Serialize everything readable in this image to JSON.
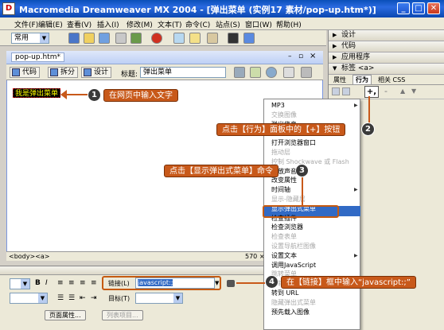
{
  "window": {
    "title": "Macromedia Dreamweaver MX 2004 - [弹出菜单 (实例17  素材/pop-up.htm*)]",
    "controls": [
      "_",
      "□",
      "✕"
    ]
  },
  "menubar": [
    "文件(F)",
    "编辑(E)",
    "查看(V)",
    "插入(I)",
    "修改(M)",
    "文本(T)",
    "命令(C)",
    "站点(S)",
    "窗口(W)",
    "帮助(H)"
  ],
  "insert_bar": {
    "category": "常用"
  },
  "right_panel": {
    "groups": [
      "设计",
      "代码",
      "应用程序",
      "标签 <a>"
    ],
    "tabs": [
      "属性",
      "行为",
      "相关 CSS"
    ],
    "add_button": "+,",
    "remove_button": "-"
  },
  "document": {
    "tab_name": "pop-up.htm*",
    "view_buttons": [
      "代码",
      "拆分",
      "设计"
    ],
    "title_label": "标题:",
    "title_value": "弹出菜单",
    "content_text": "我是弹出菜单",
    "tag_selector": "<body><a>",
    "status_right": "570 ×"
  },
  "context_menu": {
    "items": [
      {
        "label": "MP3",
        "disabled": false,
        "submenu": true
      },
      {
        "label": "交换图像",
        "disabled": true,
        "submenu": false
      },
      {
        "label": "弹出信息",
        "disabled": false,
        "submenu": false
      },
      {
        "label": "恢复交换图像",
        "disabled": true,
        "submenu": false
      },
      {
        "label": "打开浏览器窗口",
        "disabled": false,
        "submenu": false
      },
      {
        "label": "拖动层",
        "disabled": true,
        "submenu": false
      },
      {
        "label": "控制 Shockwave 或 Flash",
        "disabled": true,
        "submenu": false
      },
      {
        "label": "播放声音",
        "disabled": false,
        "submenu": false
      },
      {
        "label": "改变属性",
        "disabled": false,
        "submenu": false
      },
      {
        "label": "时间轴",
        "disabled": false,
        "submenu": true
      },
      {
        "label": "显示-隐藏层",
        "disabled": true,
        "submenu": false
      },
      {
        "label": "显示弹出式菜单",
        "disabled": false,
        "submenu": false,
        "highlighted": true
      },
      {
        "label": "检查插件",
        "disabled": false,
        "submenu": false
      },
      {
        "label": "检查浏览器",
        "disabled": false,
        "submenu": false
      },
      {
        "label": "检查表单",
        "disabled": true,
        "submenu": false
      },
      {
        "label": "设置导航栏图像",
        "disabled": true,
        "submenu": false
      },
      {
        "label": "设置文本",
        "disabled": false,
        "submenu": true
      },
      {
        "label": "调用JavaScript",
        "disabled": false,
        "submenu": false
      },
      {
        "label": "跳转菜单",
        "disabled": true,
        "submenu": false
      },
      {
        "label": "跳转菜单开始",
        "disabled": true,
        "submenu": false
      },
      {
        "label": "转到 URL",
        "disabled": false,
        "submenu": false
      },
      {
        "label": "隐藏弹出式菜单",
        "disabled": true,
        "submenu": false
      },
      {
        "label": "预先载入图像",
        "disabled": false,
        "submenu": false
      }
    ]
  },
  "properties": {
    "link_label": "链接(L)",
    "link_value": "javascript:;",
    "target_label": "目标(T)",
    "page_props_button": "页面属性...",
    "list_item_button": "列表项目..."
  },
  "callouts": [
    {
      "num": "1",
      "text": "在网页中输入文字"
    },
    {
      "num": "2",
      "text": "点击【行为】面板中的【+】按钮"
    },
    {
      "num": "3",
      "text": "点击【显示弹出式菜单】命令"
    },
    {
      "num": "4",
      "text": "在【链接】框中输入“javascript:;”"
    }
  ],
  "colors": {
    "callout": "#c8591a",
    "title_bar": "#0a4fb8",
    "highlight": "#316ac5"
  }
}
